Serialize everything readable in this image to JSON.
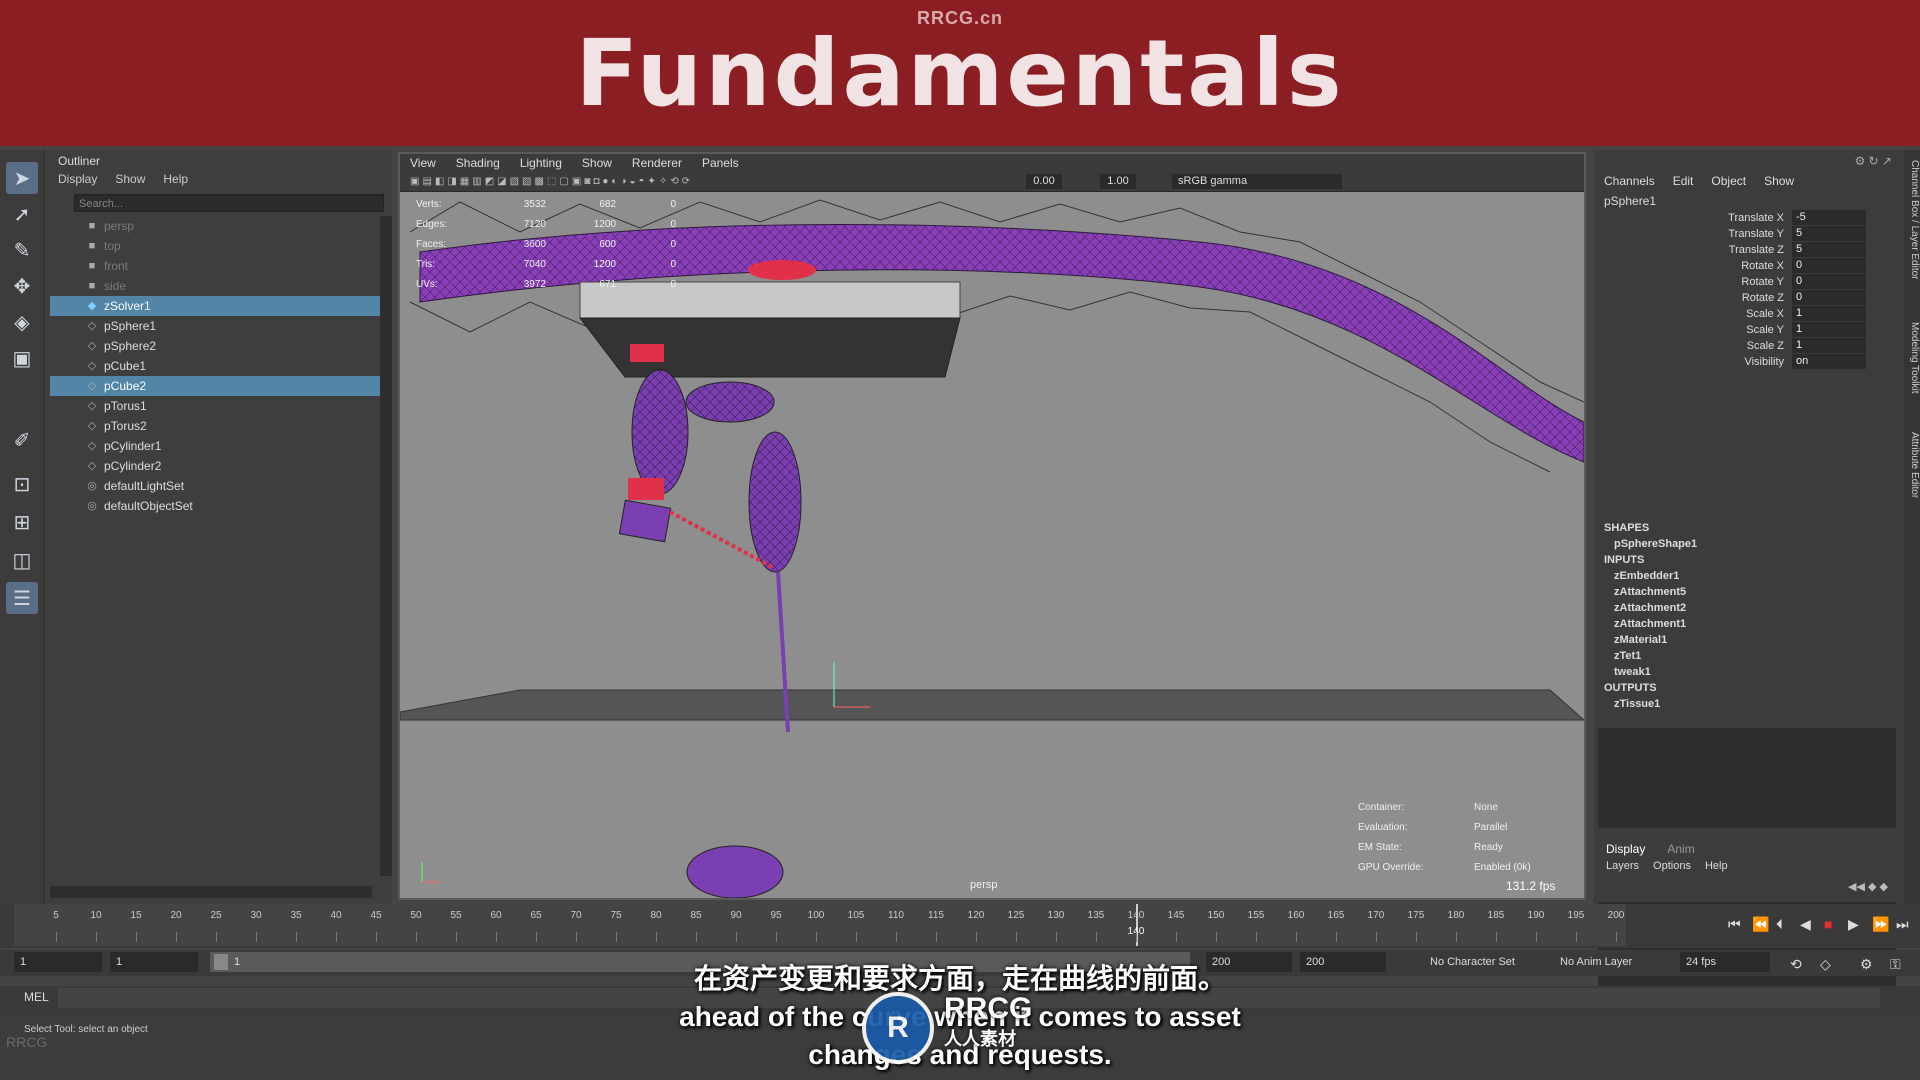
{
  "banner": {
    "site": "RRCG.cn",
    "title": "Fundamentals"
  },
  "outliner": {
    "title": "Outliner",
    "menu": [
      "Display",
      "Show",
      "Help"
    ],
    "search_placeholder": "Search...",
    "items": [
      {
        "label": "persp",
        "icon": "camera-icon"
      },
      {
        "label": "top",
        "icon": "camera-icon"
      },
      {
        "label": "front",
        "icon": "camera-icon"
      },
      {
        "label": "side",
        "icon": "camera-icon"
      },
      {
        "label": "zSolver1",
        "icon": "solver-icon"
      },
      {
        "label": "pSphere1",
        "icon": "mesh-icon"
      },
      {
        "label": "pSphere2",
        "icon": "mesh-icon"
      },
      {
        "label": "pCube1",
        "icon": "mesh-icon"
      },
      {
        "label": "pCube2",
        "icon": "mesh-icon"
      },
      {
        "label": "pTorus1",
        "icon": "mesh-icon"
      },
      {
        "label": "pTorus2",
        "icon": "mesh-icon"
      },
      {
        "label": "pCylinder1",
        "icon": "mesh-icon"
      },
      {
        "label": "pCylinder2",
        "icon": "mesh-icon"
      },
      {
        "label": "defaultLightSet",
        "icon": "set-icon"
      },
      {
        "label": "defaultObjectSet",
        "icon": "set-icon"
      }
    ]
  },
  "viewport": {
    "menu": [
      "View",
      "Shading",
      "Lighting",
      "Show",
      "Renderer",
      "Panels"
    ],
    "field1": "0.00",
    "field2": "1.00",
    "color_space": "sRGB gamma",
    "hud": {
      "verts": [
        "Verts:",
        "3532",
        "682",
        "0"
      ],
      "edges": [
        "Edges:",
        "7120",
        "1200",
        "0"
      ],
      "faces": [
        "Faces:",
        "3600",
        "600",
        "0"
      ],
      "tris": [
        "Tris:",
        "7040",
        "1200",
        "0"
      ],
      "uvs": [
        "UVs:",
        "3972",
        "671",
        "0"
      ]
    },
    "info": {
      "container_k": "Container:",
      "container_v": "None",
      "evaluation_k": "Evaluation:",
      "evaluation_v": "Parallel",
      "em_k": "EM State:",
      "em_v": "Ready",
      "gpu_k": "GPU Override:",
      "gpu_v": "Enabled (0k)"
    },
    "fps": "131.2 fps",
    "camera": "persp"
  },
  "channel_box": {
    "menu": [
      "Channels",
      "Edit",
      "Object",
      "Show"
    ],
    "object": "pSphere1",
    "attrs": [
      {
        "name": "Translate X",
        "value": "-5"
      },
      {
        "name": "Translate Y",
        "value": "5"
      },
      {
        "name": "Translate Z",
        "value": "5"
      },
      {
        "name": "Rotate X",
        "value": "0"
      },
      {
        "name": "Rotate Y",
        "value": "0"
      },
      {
        "name": "Rotate Z",
        "value": "0"
      },
      {
        "name": "Scale X",
        "value": "1"
      },
      {
        "name": "Scale Y",
        "value": "1"
      },
      {
        "name": "Scale Z",
        "value": "1"
      },
      {
        "name": "Visibility",
        "value": "on"
      }
    ],
    "shapes_header": "SHAPES",
    "shapes": [
      "pSphereShape1"
    ],
    "inputs_header": "INPUTS",
    "inputs": [
      "zEmbedder1",
      "zAttachment5",
      "zAttachment2",
      "zAttachment1",
      "zMaterial1",
      "zTet1",
      "tweak1"
    ],
    "outputs_header": "OUTPUTS",
    "outputs": [
      "zTissue1"
    ],
    "layer_tabs": [
      "Display",
      "Anim"
    ],
    "layer_menu": [
      "Layers",
      "Options",
      "Help"
    ],
    "side_tabs": [
      "Channel Box / Layer Editor",
      "Modeling Toolkit",
      "Attribute Editor"
    ]
  },
  "timeline": {
    "ticks": [
      5,
      10,
      15,
      20,
      25,
      30,
      35,
      40,
      45,
      50,
      55,
      60,
      65,
      70,
      75,
      80,
      85,
      90,
      95,
      100,
      105,
      110,
      115,
      120,
      125,
      130,
      135,
      140,
      145,
      150,
      155,
      160,
      165,
      170,
      175,
      180,
      185,
      190,
      195,
      200
    ],
    "start": 1,
    "end": 200,
    "current_frame": "140"
  },
  "range": {
    "start_field": "1",
    "playback_start": "1",
    "slider_label": "1",
    "playback_end": "200",
    "end_field": "200",
    "character_set": "No Character Set",
    "anim_layer": "No Anim Layer",
    "fps": "24 fps"
  },
  "command": {
    "mel_label": "MEL",
    "help": "Select Tool: select an object"
  },
  "subtitles": {
    "zh": "在资产变更和要求方面，走在曲线的前面。",
    "en1": "ahead of the curve when it comes to asset",
    "en2": "changes and requests."
  },
  "watermark": {
    "logo": "R",
    "line1": "RRCG",
    "line2": "人人素材",
    "corner": "RRCG"
  }
}
